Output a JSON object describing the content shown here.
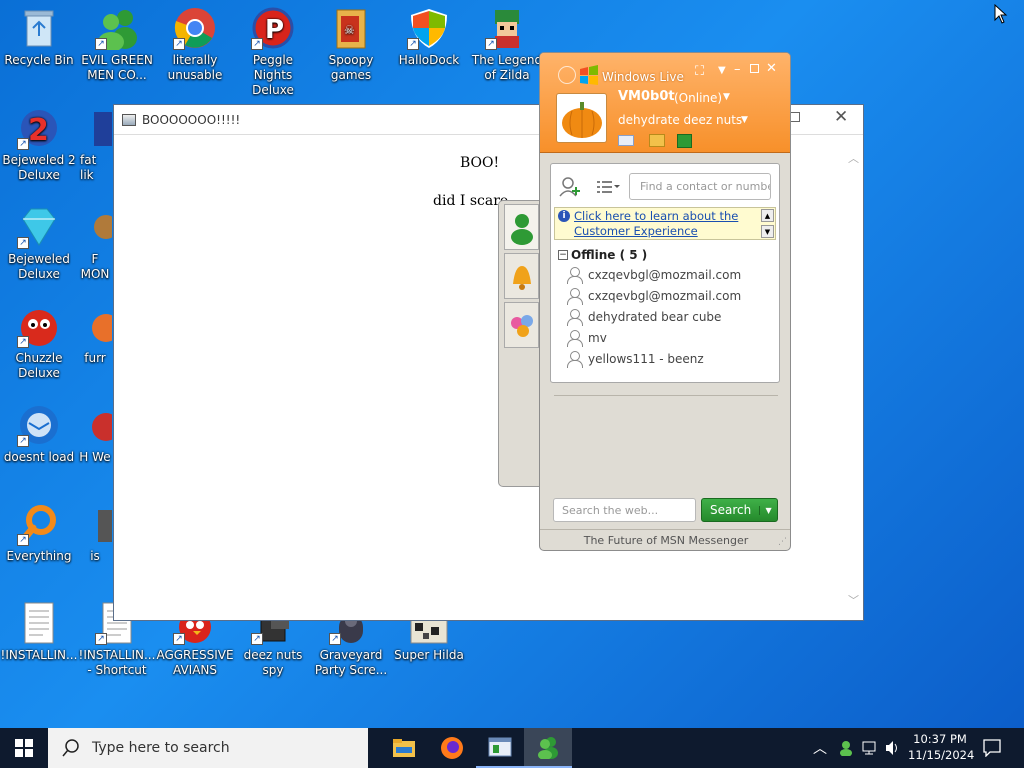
{
  "desktop": {
    "icons": [
      {
        "label": "Recycle Bin"
      },
      {
        "label": "EVIL GREEN MEN CO..."
      },
      {
        "label": "literally unusable"
      },
      {
        "label": "Peggle Nights Deluxe"
      },
      {
        "label": "Spoopy games"
      },
      {
        "label": "HalloDock"
      },
      {
        "label": "The Legend of Zilda"
      },
      {
        "label": "Bejeweled 2 Deluxe"
      },
      {
        "label": "fat lik"
      },
      {
        "label": "Bejeweled Deluxe"
      },
      {
        "label": "F MON"
      },
      {
        "label": "Chuzzle Deluxe"
      },
      {
        "label": "furr"
      },
      {
        "label": "doesnt load"
      },
      {
        "label": "H We"
      },
      {
        "label": "Everything"
      },
      {
        "label": "is"
      },
      {
        "label": "!INSTALLIN..."
      },
      {
        "label": "!INSTALLIN... - Shortcut"
      },
      {
        "label": "AGGRESSIVE AVIANS"
      },
      {
        "label": "deez nuts spy"
      },
      {
        "label": "Graveyard Party Scre..."
      },
      {
        "label": "Super Hilda"
      }
    ]
  },
  "ie_window": {
    "title": "BOOOOOOO!!!!!",
    "heading": "BOO!",
    "body_text": "did I scare"
  },
  "msn": {
    "title": "Windows Live",
    "username": "VM0b0t",
    "status": "(Online)",
    "personal_message": "dehydrate deez nuts",
    "search_contact_placeholder": "Find a contact or number...",
    "info_link": "Click here to learn about the Customer Experience",
    "group_label": "Offline ( 5 )",
    "contacts": [
      {
        "name": "cxzqevbgl@mozmail.com"
      },
      {
        "name": "cxzqevbgl@mozmail.com"
      },
      {
        "name": "dehydrated bear cube"
      },
      {
        "name": "mv"
      },
      {
        "name": "yellows111 - beenz"
      }
    ],
    "web_search_placeholder": "Search the web...",
    "search_button": "Search",
    "footer": "The Future of MSN Messenger",
    "accent_color": "#f7902a",
    "search_button_color": "#2e9a35"
  },
  "taskbar": {
    "search_placeholder": "Type here to search",
    "time": "10:37 PM",
    "date": "11/15/2024",
    "pinned": [
      "file-explorer-icon",
      "firefox-icon",
      "ie-window-icon",
      "msn-messenger-icon"
    ]
  }
}
